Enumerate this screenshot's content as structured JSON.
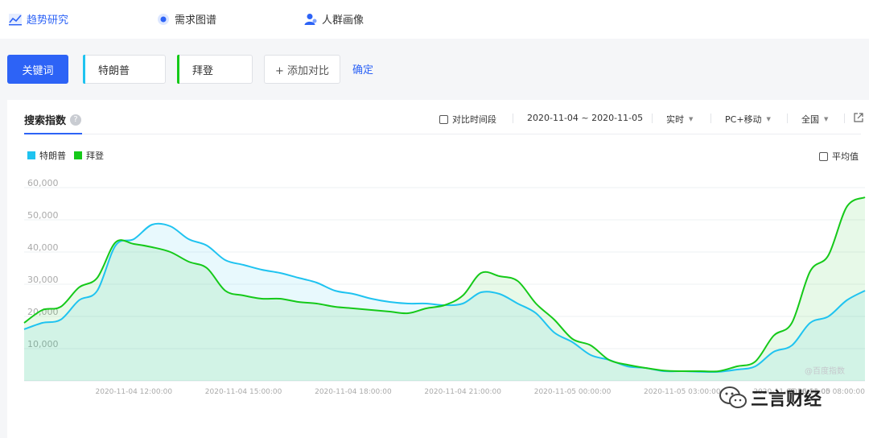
{
  "nav": {
    "items": [
      {
        "label": "趋势研究",
        "icon": "chart-icon",
        "active": true
      },
      {
        "label": "需求图谱",
        "icon": "radar-icon",
        "active": false
      },
      {
        "label": "人群画像",
        "icon": "user-icon",
        "active": false
      }
    ]
  },
  "keywords": {
    "button_label": "关键词",
    "items": [
      {
        "label": "特朗普",
        "color": "#1fc3f0"
      },
      {
        "label": "拜登",
        "color": "#15c919"
      }
    ],
    "add_label": "+ 添加对比",
    "confirm_label": "确定"
  },
  "card": {
    "title": "搜索指数",
    "help": "?",
    "compare_label": "对比时间段",
    "date_range": "2020-11-04 ~ 2020-11-05",
    "granularity": "实时",
    "device": "PC+移动",
    "region": "全国",
    "avg_label": "平均值",
    "watermark": "@百度指数",
    "wechat": "三言财经"
  },
  "chart_data": {
    "type": "area",
    "xlabel": "",
    "ylabel": "",
    "ylim": [
      0,
      60000
    ],
    "yticks": [
      "60,000",
      "50,000",
      "40,000",
      "30,000",
      "20,000",
      "10,000"
    ],
    "xtick_labels": [
      "2020-11-04 12:00:00",
      "2020-11-04 15:00:00",
      "2020-11-04 18:00:00",
      "2020-11-04 21:00:00",
      "2020-11-05 00:00:00",
      "2020-11-05 03:00:00",
      "2020-11-05 06:00:00",
      "2020-11-05 08:00:00"
    ],
    "x_hours": [
      9.0,
      9.5,
      10.0,
      10.5,
      11.0,
      11.5,
      12.0,
      12.5,
      13.0,
      13.5,
      14.0,
      14.5,
      15.0,
      15.5,
      16.0,
      16.5,
      17.0,
      17.5,
      18.0,
      18.5,
      19.0,
      19.5,
      20.0,
      20.5,
      21.0,
      21.5,
      22.0,
      22.5,
      23.0,
      23.5,
      24.0,
      24.5,
      25.0,
      25.5,
      26.0,
      26.5,
      27.0,
      27.5,
      28.0,
      28.5,
      29.0,
      29.5,
      30.0,
      30.5,
      31.0,
      31.5,
      32.0
    ],
    "grid": true,
    "legend": "top-left",
    "series": [
      {
        "name": "特朗普",
        "color": "#1fc3f0",
        "values": [
          16000,
          18000,
          19000,
          25000,
          28000,
          42000,
          44000,
          48500,
          48000,
          44000,
          42000,
          37500,
          36000,
          34500,
          33500,
          32000,
          30500,
          28000,
          27000,
          25500,
          24500,
          24000,
          24000,
          23500,
          24000,
          27500,
          27000,
          24000,
          21000,
          15000,
          12000,
          8000,
          6500,
          4500,
          4000,
          3000,
          3000,
          2800,
          2800,
          3500,
          4500,
          9000,
          11000,
          18000,
          20000,
          25000,
          28000
        ]
      },
      {
        "name": "拜登",
        "color": "#15c919",
        "values": [
          18000,
          22000,
          23000,
          29000,
          32000,
          43000,
          42500,
          41500,
          40000,
          37000,
          35000,
          28000,
          26500,
          25500,
          25500,
          24500,
          24000,
          23000,
          22500,
          22000,
          21500,
          21000,
          22500,
          23500,
          26500,
          33500,
          32500,
          31000,
          24000,
          19000,
          13000,
          11000,
          6500,
          5000,
          4000,
          3200,
          3000,
          3000,
          3000,
          4500,
          6000,
          14000,
          18000,
          34000,
          39000,
          54000,
          57000
        ]
      }
    ]
  }
}
